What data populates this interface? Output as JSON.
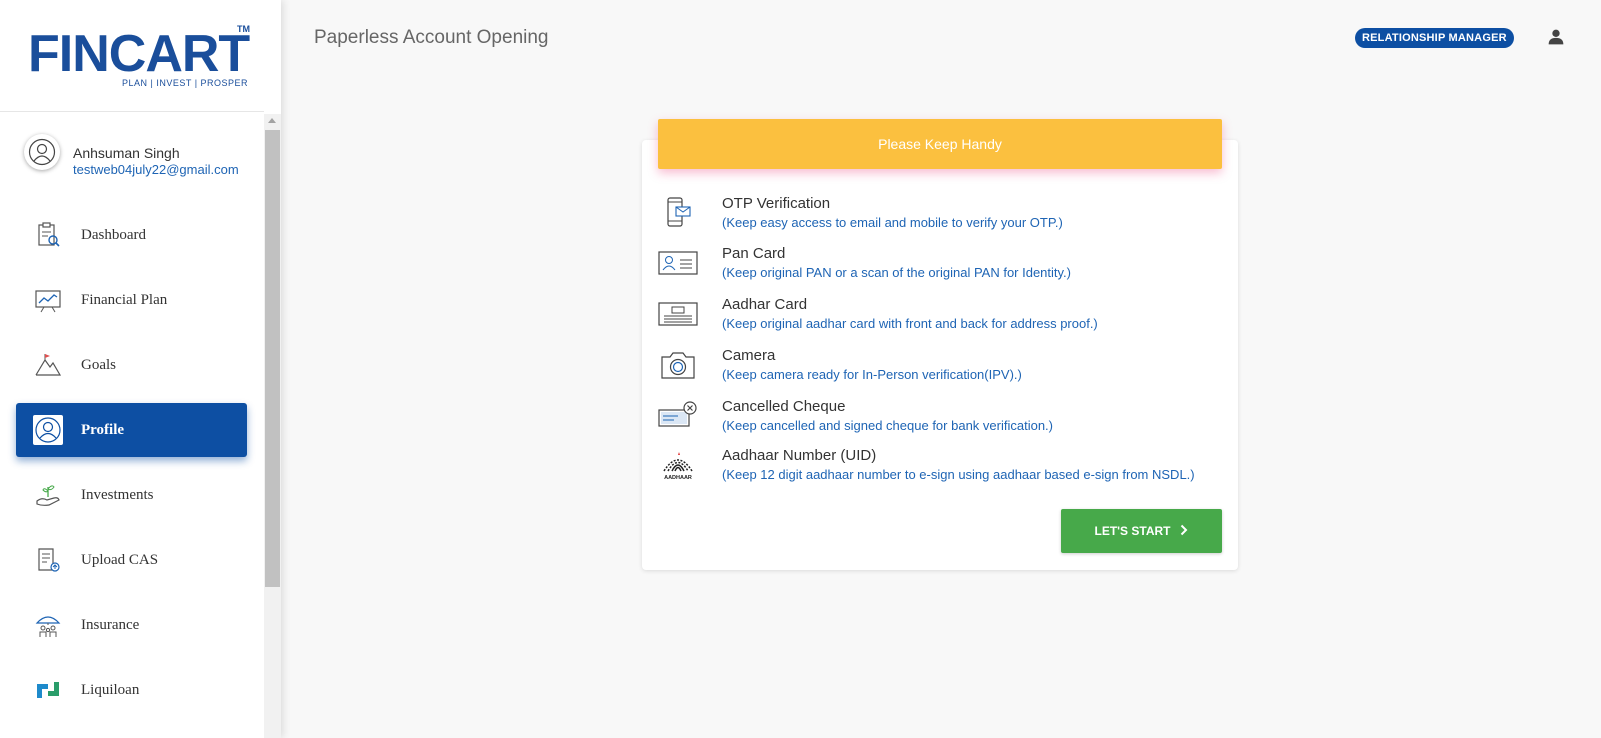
{
  "app": {
    "logo_text": "FINCART",
    "logo_tagline": "PLAN | INVEST | PROSPER",
    "logo_tm": "TM"
  },
  "header": {
    "title": "Paperless Account Opening",
    "role_badge": "RELATIONSHIP  MANAGER"
  },
  "user": {
    "name": "Anhsuman Singh",
    "email": "testweb04july22@gmail.com"
  },
  "sidebar": {
    "items": [
      {
        "label": "Dashboard",
        "icon": "dashboard-icon"
      },
      {
        "label": "Financial Plan",
        "icon": "financial-plan-icon"
      },
      {
        "label": "Goals",
        "icon": "goals-icon"
      },
      {
        "label": "Profile",
        "icon": "profile-icon",
        "active": true
      },
      {
        "label": "Investments",
        "icon": "investments-icon"
      },
      {
        "label": "Upload CAS",
        "icon": "upload-cas-icon"
      },
      {
        "label": "Insurance",
        "icon": "insurance-icon"
      },
      {
        "label": "Liquiloan",
        "icon": "liquiloan-icon"
      }
    ]
  },
  "card": {
    "header": "Please Keep Handy",
    "requirements": [
      {
        "title": "OTP Verification",
        "desc": "(Keep easy access to email and mobile to verify your OTP.)",
        "icon": "otp-phone-icon"
      },
      {
        "title": "Pan Card",
        "desc": "(Keep original PAN or a scan of the original PAN for Identity.)",
        "icon": "pan-card-icon"
      },
      {
        "title": "Aadhar Card",
        "desc": "(Keep original aadhar card with front and back for address proof.)",
        "icon": "aadhar-card-icon"
      },
      {
        "title": "Camera",
        "desc": "(Keep camera ready for In-Person verification(IPV).)",
        "icon": "camera-icon"
      },
      {
        "title": "Cancelled Cheque",
        "desc": "(Keep cancelled and signed cheque for bank verification.)",
        "icon": "cancelled-cheque-icon"
      },
      {
        "title": "Aadhaar Number (UID)",
        "desc": "(Keep 12 digit aadhaar number to e-sign using aadhaar based e-sign from NSDL.)",
        "icon": "aadhaar-logo-icon",
        "icon_text": "AADHAAR"
      }
    ],
    "start_button": "LET'S START"
  },
  "colors": {
    "primary": "#0d4fa3",
    "header_yellow": "#fbc03f",
    "start_green": "#47a94a",
    "link_blue": "#1e64b4",
    "logo_orange": "#f5a623"
  }
}
